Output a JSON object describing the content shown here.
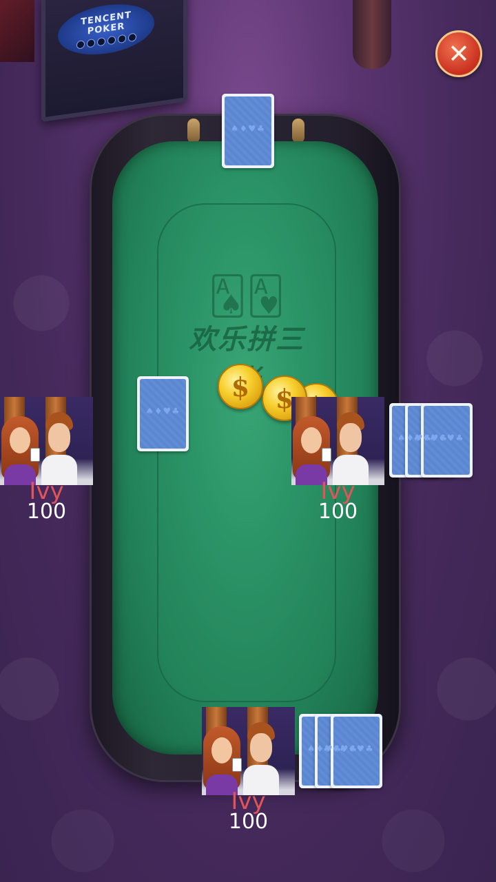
{
  "background_sign": {
    "line1": "TENCENT",
    "line2": "POKER"
  },
  "table_logo": {
    "text": "欢乐拼三张"
  },
  "close_button": {
    "icon": "close-icon",
    "glyph": "✕"
  },
  "card_back": {
    "suits": "♠♦♥♣"
  },
  "coin": {
    "glyph": "$"
  },
  "players": [
    {
      "seat": "left",
      "name": "Ivy",
      "score": "100",
      "cards_shown": 1
    },
    {
      "seat": "right",
      "name": "Ivy",
      "score": "100",
      "cards_shown": 3
    },
    {
      "seat": "bottom",
      "name": "Ivy",
      "score": "100",
      "cards_shown": 3
    }
  ],
  "dealer_cards_shown": 1,
  "pot_coins": 3,
  "colors": {
    "felt": "#2b9568",
    "card_back": "#5a86d2",
    "player_name": "#e0555a",
    "close_button": "#c9301f"
  }
}
